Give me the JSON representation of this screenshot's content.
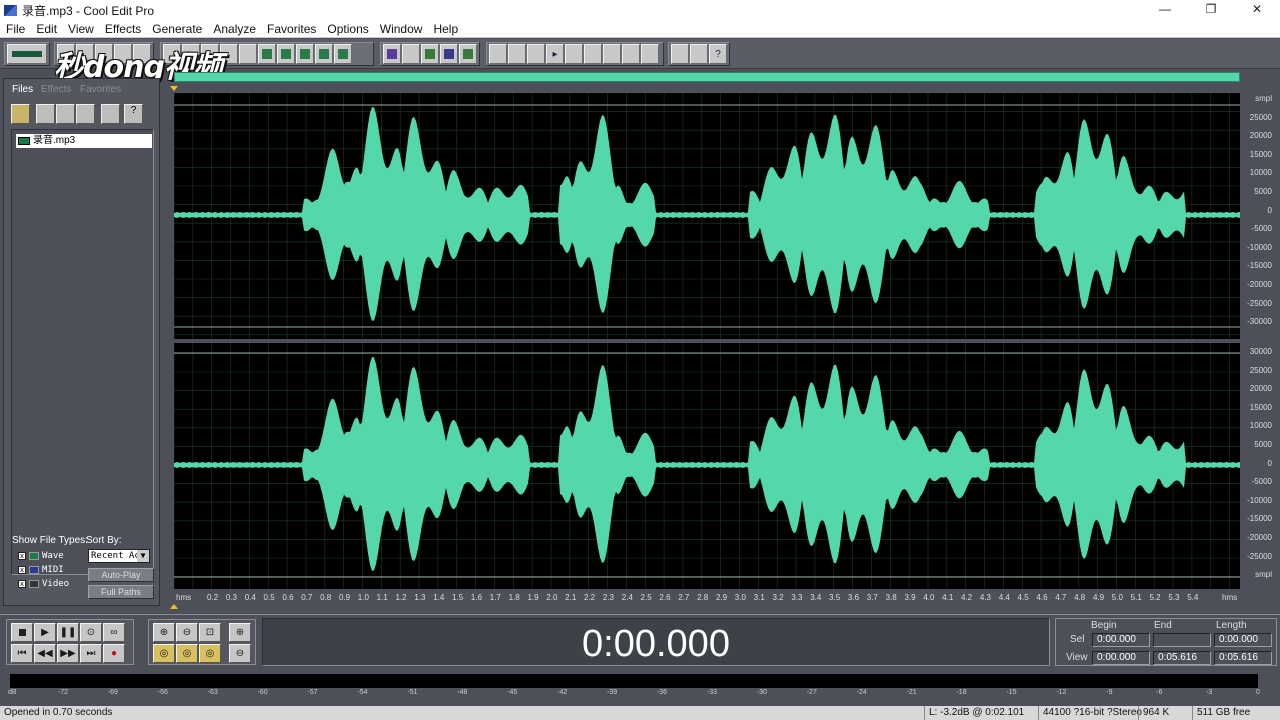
{
  "window": {
    "title": "录音.mp3 - Cool Edit Pro",
    "minimize": "—",
    "maximize": "❐",
    "close": "✕"
  },
  "menu": [
    "File",
    "Edit",
    "View",
    "Effects",
    "Generate",
    "Analyze",
    "Favorites",
    "Options",
    "Window",
    "Help"
  ],
  "watermark": "秒dong视频",
  "left_panel": {
    "tabs": [
      "Files",
      "Effects",
      "Favorites"
    ],
    "files": [
      "录音.mp3"
    ],
    "show_file_types_label": "Show File Types:",
    "sort_by_label": "Sort By:",
    "file_types": [
      "Wave",
      "MIDI",
      "Video"
    ],
    "sort_value": "Recent Ac",
    "auto_play": "Auto-Play",
    "full_paths": "Full Paths"
  },
  "waveform": {
    "color": "#54d7a9",
    "y_unit": "smpl",
    "y_ticks_top": [
      "smpl",
      "25000",
      "20000",
      "15000",
      "10000",
      "5000",
      "0",
      "-5000",
      "-10000",
      "-15000",
      "-20000",
      "-25000",
      "-30000"
    ],
    "y_ticks_bottom": [
      "30000",
      "25000",
      "20000",
      "15000",
      "10000",
      "5000",
      "0",
      "-5000",
      "-10000",
      "-15000",
      "-20000",
      "-25000",
      "smpl"
    ],
    "x_unit": "hms",
    "x_ticks": [
      "0.2",
      "0.3",
      "0.4",
      "0.5",
      "0.6",
      "0.7",
      "0.8",
      "0.9",
      "1.0",
      "1.1",
      "1.2",
      "1.3",
      "1.4",
      "1.5",
      "1.6",
      "1.7",
      "1.8",
      "1.9",
      "2.0",
      "2.1",
      "2.2",
      "2.3",
      "2.4",
      "2.5",
      "2.6",
      "2.7",
      "2.8",
      "2.9",
      "3.0",
      "3.1",
      "3.2",
      "3.3",
      "3.4",
      "3.5",
      "3.6",
      "3.7",
      "3.8",
      "3.9",
      "4.0",
      "4.1",
      "4.2",
      "4.3",
      "4.4",
      "4.5",
      "4.6",
      "4.7",
      "4.8",
      "4.9",
      "5.0",
      "5.1",
      "5.2",
      "5.3",
      "5.4"
    ],
    "x_unit_right": "hms"
  },
  "time_display": "0:00.000",
  "selection": {
    "headers": [
      "Begin",
      "End",
      "Length"
    ],
    "sel_label": "Sel",
    "view_label": "View",
    "sel": [
      "0:00.000",
      "",
      "0:00.000"
    ],
    "view": [
      "0:00.000",
      "0:05.616",
      "0:05.616"
    ]
  },
  "level_ticks": [
    "dB",
    "-72",
    "-69",
    "-66",
    "-63",
    "-60",
    "-57",
    "-54",
    "-51",
    "-48",
    "-45",
    "-42",
    "-39",
    "-36",
    "-33",
    "-30",
    "-27",
    "-24",
    "-21",
    "-18",
    "-15",
    "-12",
    "-9",
    "-6",
    "-3",
    "0"
  ],
  "status": {
    "message": "Opened in 0.70 seconds",
    "level": "L: -3.2dB @  0:02.101",
    "format": "44100 ?16-bit ?Stereo",
    "size": "964 K",
    "free": "511 GB free"
  }
}
